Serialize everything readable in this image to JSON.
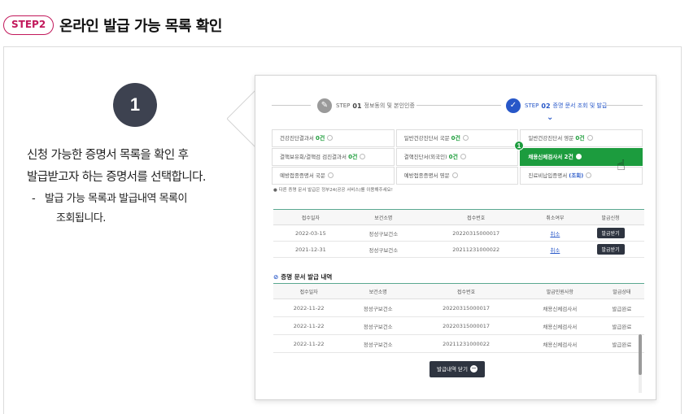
{
  "step": {
    "badge": "STEP2",
    "title": "온라인 발급 가능 목록 확인"
  },
  "guide": {
    "number": "1",
    "line1": "신청 가능한 증명서 목록을 확인 후",
    "line2": "발급받고자 하는 증명서를 선택합니다.",
    "sub_dash": "-",
    "sub_line1": "발급 가능 목록과 발급내역 목록이",
    "sub_line2": "조회됩니다."
  },
  "mock": {
    "progress": {
      "step1_prefix": "STEP",
      "step1_num": "01",
      "step1_label": "정보동의 및 본인인증",
      "step2_prefix": "STEP",
      "step2_num": "02",
      "step2_label": "증명 문서 조회 및 발급"
    },
    "certs": [
      {
        "name": "건강진단결과서",
        "count": "0건"
      },
      {
        "name": "일반건강진단서 국문",
        "count": "0건"
      },
      {
        "name": "일반건강진단서 영문",
        "count": "0건"
      },
      {
        "name": "결핵보유회/결핵검 검진결과서",
        "count": "0건"
      },
      {
        "name": "결핵진단서(외국인)",
        "count": "0건"
      },
      {
        "name": "채용신체검사서",
        "count": "2건"
      },
      {
        "name": "예방접종증명서 국문",
        "count": ""
      },
      {
        "name": "예방접종증명서 영문",
        "count": ""
      },
      {
        "name": "진료비납입증명서",
        "count": "(조회)"
      }
    ],
    "selected_badge": "1",
    "notice": "다른 증명 문서 발급은 정부24(공공 서비스)를 이용해주세요!",
    "table1": {
      "headers": [
        "접수일자",
        "보건소명",
        "접수번호",
        "취소여부",
        "발급신청"
      ],
      "rows": [
        {
          "date": "2022-03-15",
          "center": "정성구보건소",
          "no": "20220315000017",
          "status": "취소",
          "action": "발급받기"
        },
        {
          "date": "2021-12-31",
          "center": "정성구보건소",
          "no": "20211231000022",
          "status": "취소",
          "action": "발급받기"
        }
      ]
    },
    "history_title": "증명 문서 발급 내역",
    "table2": {
      "headers": [
        "접수일자",
        "보건소명",
        "접수번호",
        "발급민원사항",
        "발급상태"
      ],
      "rows": [
        {
          "date": "2022-11-22",
          "center": "정성구보건소",
          "no": "20220315000017",
          "type": "채용신체검사서",
          "state": "발급완료"
        },
        {
          "date": "2022-11-22",
          "center": "정성구보건소",
          "no": "20220315000017",
          "type": "채용신체검사서",
          "state": "발급완료"
        },
        {
          "date": "2022-11-22",
          "center": "정성구보건소",
          "no": "20211231000022",
          "type": "채용신체검사서",
          "state": "발급완료"
        }
      ]
    },
    "close_button": "발급내역 닫기"
  }
}
